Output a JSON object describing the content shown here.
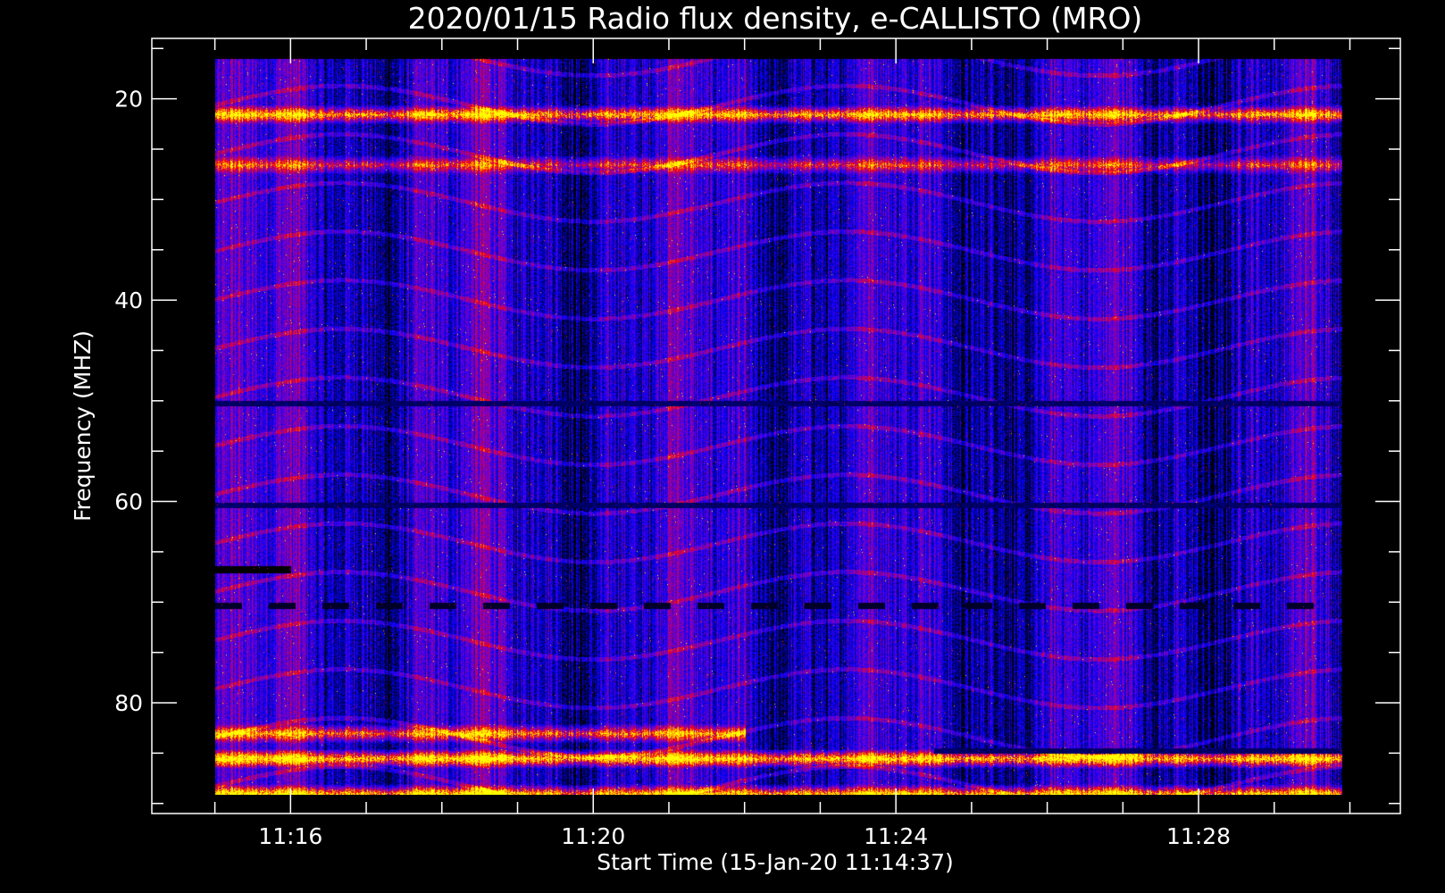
{
  "chart_data": {
    "type": "heatmap",
    "title": "2020/01/15  Radio flux density, e-CALLISTO (MRO)",
    "xlabel": "Start Time (15-Jan-20 11:14:37)",
    "ylabel": "Frequency (MHZ)",
    "x_range": [
      "11:15:00",
      "11:30:00"
    ],
    "x_axis_range": [
      "11:14:10",
      "11:30:40"
    ],
    "x_ticks": [
      "11:16",
      "11:20",
      "11:24",
      "11:28"
    ],
    "y_range": [
      16,
      90
    ],
    "y_axis_range": [
      14,
      91
    ],
    "y_ticks": [
      20,
      40,
      60,
      80
    ],
    "y_inverted": true,
    "colormap": [
      "#000000",
      "#0000ff",
      "#7f00c8",
      "#ff0000",
      "#ffff00"
    ],
    "background": "#000000",
    "grid": false,
    "legend": "none",
    "features": [
      {
        "kind": "band",
        "freq": 21.5,
        "intensity": 0.8
      },
      {
        "kind": "band",
        "freq": 26.5,
        "intensity": 0.55
      },
      {
        "kind": "dark_line",
        "freq": 50.2
      },
      {
        "kind": "dark_line",
        "freq": 60.3
      },
      {
        "kind": "dashed_dark_line",
        "freq": 70.3
      },
      {
        "kind": "dark_segment",
        "freq": 66.7,
        "start": "11:15:00",
        "end": "11:16:00"
      },
      {
        "kind": "band",
        "freq": 83.0,
        "intensity": 0.7,
        "start": "11:15:00",
        "end": "11:22:00"
      },
      {
        "kind": "band",
        "freq": 85.5,
        "intensity": 0.9
      },
      {
        "kind": "band",
        "freq": 89.0,
        "intensity": 0.85
      },
      {
        "kind": "dark_line",
        "freq": 84.7,
        "start": "11:24:30",
        "end": "11:30:00"
      }
    ]
  }
}
